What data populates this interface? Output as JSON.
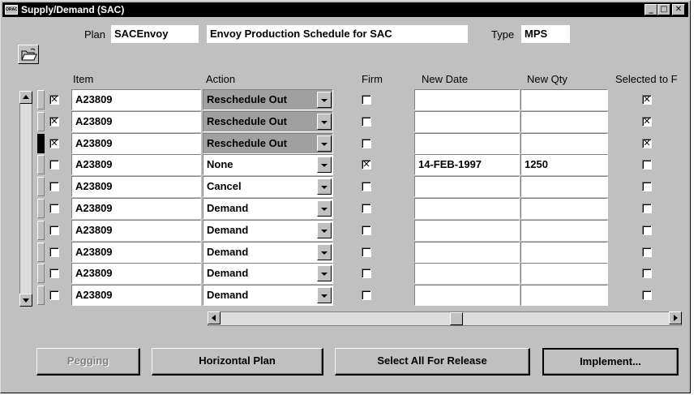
{
  "window": {
    "title": "Supply/Demand (SAC)",
    "app_icon_text": "ORACLE"
  },
  "header": {
    "plan_label": "Plan",
    "plan_value": "SACEnvoy",
    "plan_desc": "Envoy Production Schedule for SAC",
    "type_label": "Type",
    "type_value": "MPS"
  },
  "columns": {
    "item": "Item",
    "action": "Action",
    "firm": "Firm",
    "new_date": "New Date",
    "new_qty": "New Qty",
    "selected": "Selected to F"
  },
  "rows": [
    {
      "selected": true,
      "item": "A23809",
      "action": "Reschedule Out",
      "firm": false,
      "new_date": "",
      "new_qty": "",
      "release": true
    },
    {
      "selected": true,
      "item": "A23809",
      "action": "Reschedule Out",
      "firm": false,
      "new_date": "",
      "new_qty": "",
      "release": true
    },
    {
      "selected": true,
      "item": "A23809",
      "action": "Reschedule Out",
      "firm": false,
      "new_date": "",
      "new_qty": "",
      "release": true
    },
    {
      "selected": false,
      "item": "A23809",
      "action": "None",
      "firm": true,
      "new_date": "14-FEB-1997",
      "new_qty": "1250",
      "release": false
    },
    {
      "selected": false,
      "item": "A23809",
      "action": "Cancel",
      "firm": false,
      "new_date": "",
      "new_qty": "",
      "release": false
    },
    {
      "selected": false,
      "item": "A23809",
      "action": "Demand",
      "firm": false,
      "new_date": "",
      "new_qty": "",
      "release": false
    },
    {
      "selected": false,
      "item": "A23809",
      "action": "Demand",
      "firm": false,
      "new_date": "",
      "new_qty": "",
      "release": false
    },
    {
      "selected": false,
      "item": "A23809",
      "action": "Demand",
      "firm": false,
      "new_date": "",
      "new_qty": "",
      "release": false
    },
    {
      "selected": false,
      "item": "A23809",
      "action": "Demand",
      "firm": false,
      "new_date": "",
      "new_qty": "",
      "release": false
    },
    {
      "selected": false,
      "item": "A23809",
      "action": "Demand",
      "firm": false,
      "new_date": "",
      "new_qty": "",
      "release": false
    }
  ],
  "buttons": {
    "pegging": "Pegging",
    "horizontal_plan": "Horizontal Plan",
    "select_all": "Select All For Release",
    "implement": "Implement..."
  },
  "check_glyph": "✕"
}
